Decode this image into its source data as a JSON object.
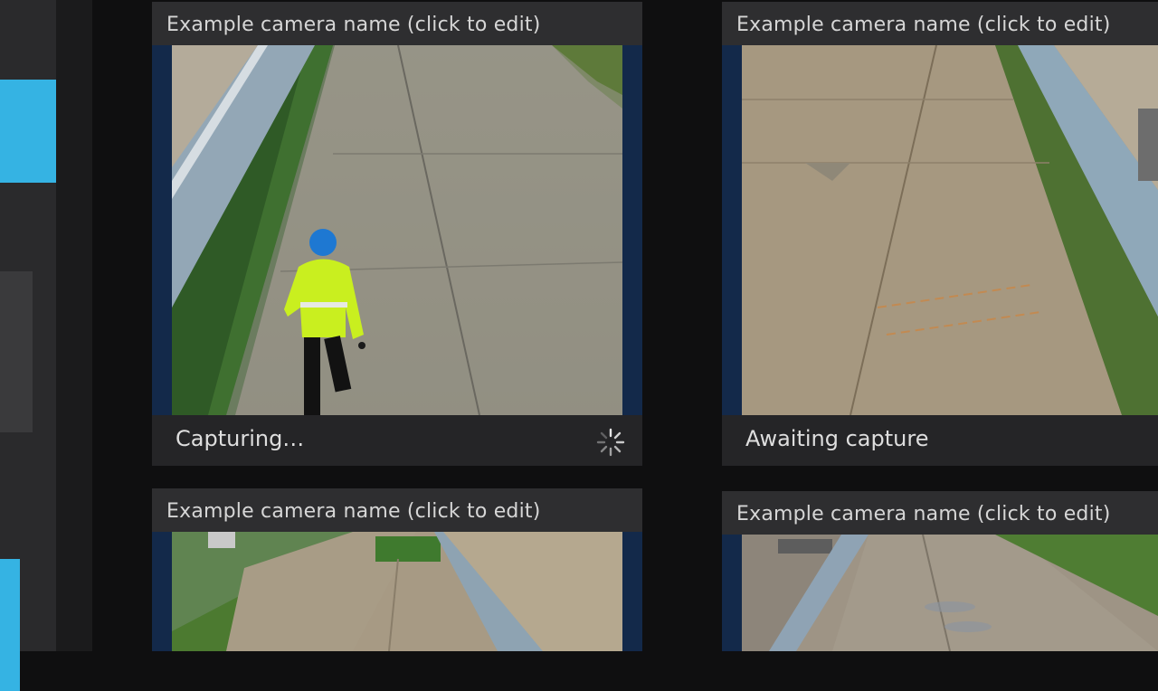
{
  "cameras": [
    {
      "title": "Example camera name (click to edit)",
      "status": "Capturing…",
      "state": "capturing"
    },
    {
      "title": "Example camera name (click to edit)",
      "status": "Awaiting capture",
      "state": "awaiting"
    },
    {
      "title": "Example camera name (click to edit)"
    },
    {
      "title": "Example camera name (click to edit)"
    }
  ],
  "icons": {
    "spinner": "loading-spinner-icon"
  },
  "colors": {
    "accent": "#35b3e3",
    "frame": "#13294a",
    "panel": "#222224",
    "header": "#2e2e30"
  }
}
